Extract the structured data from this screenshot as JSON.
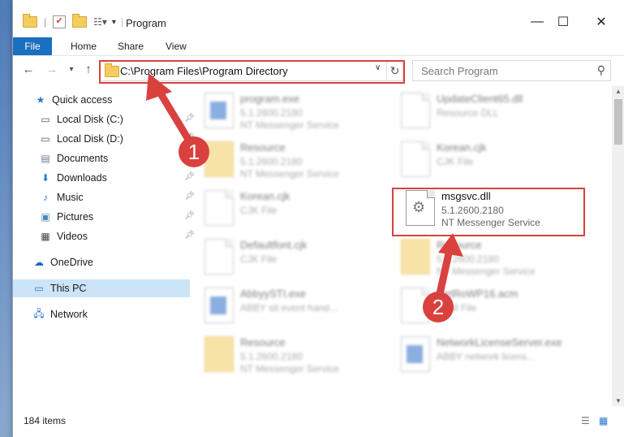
{
  "window": {
    "title": "Program"
  },
  "ribbon": {
    "tabs": [
      "File",
      "Home",
      "Share",
      "View"
    ]
  },
  "address": {
    "path": "C:\\Program Files\\Program Directory"
  },
  "search": {
    "placeholder": "Search Program"
  },
  "sidebar": {
    "items": [
      {
        "label": "Quick access",
        "icon": "star-icon",
        "pinned": false
      },
      {
        "label": "Local Disk (C:)",
        "icon": "drive-icon",
        "pinned": true
      },
      {
        "label": "Local Disk (D:)",
        "icon": "drive-icon",
        "pinned": true
      },
      {
        "label": "Documents",
        "icon": "documents-icon",
        "pinned": true
      },
      {
        "label": "Downloads",
        "icon": "download-icon",
        "pinned": true
      },
      {
        "label": "Music",
        "icon": "music-icon",
        "pinned": true
      },
      {
        "label": "Pictures",
        "icon": "pictures-icon",
        "pinned": true
      },
      {
        "label": "Videos",
        "icon": "videos-icon",
        "pinned": true
      },
      {
        "label": "OneDrive",
        "icon": "cloud-icon",
        "pinned": false
      },
      {
        "label": "This PC",
        "icon": "computer-icon",
        "pinned": false,
        "selected": true
      },
      {
        "label": "Network",
        "icon": "network-icon",
        "pinned": false
      }
    ]
  },
  "files": [
    {
      "name": "program.exe",
      "line2": "5.1.2600.2180",
      "line3": "NT Messenger Service"
    },
    {
      "name": "UpdateClient65.dll",
      "line2": "Resource DLL",
      "line3": ""
    },
    {
      "name": "Resource",
      "line2": "5.1.2600.2180",
      "line3": "NT Messenger Service"
    },
    {
      "name": "Korean.cjk",
      "line2": "CJK File",
      "line3": ""
    },
    {
      "name": "Korean.cjk",
      "line2": "CJK File",
      "line3": ""
    },
    {
      "name": "msgsvc.dll",
      "line2": "5.1.2600.2180",
      "line3": "NT Messenger Service"
    },
    {
      "name": "Defaultfont.cjk",
      "line2": "CJK File",
      "line3": ""
    },
    {
      "name": "Resource",
      "line2": "5.1.2600.2180",
      "line3": "NT Messenger Service"
    },
    {
      "name": "AbbyySTI.exe",
      "line2": "ABBY sti event hand...",
      "line3": ""
    },
    {
      "name": "NetRoWP16.acm",
      "line2": "ACM File",
      "line3": ""
    },
    {
      "name": "Resource",
      "line2": "5.1.2600.2180",
      "line3": "NT Messenger Service"
    },
    {
      "name": "NetworkLicenseServer.exe",
      "line2": "ABBY network licens...",
      "line3": ""
    }
  ],
  "annotations": {
    "badge1": "1",
    "badge2": "2",
    "accent": "#d9413f"
  },
  "status": {
    "item_count": "184 items"
  }
}
